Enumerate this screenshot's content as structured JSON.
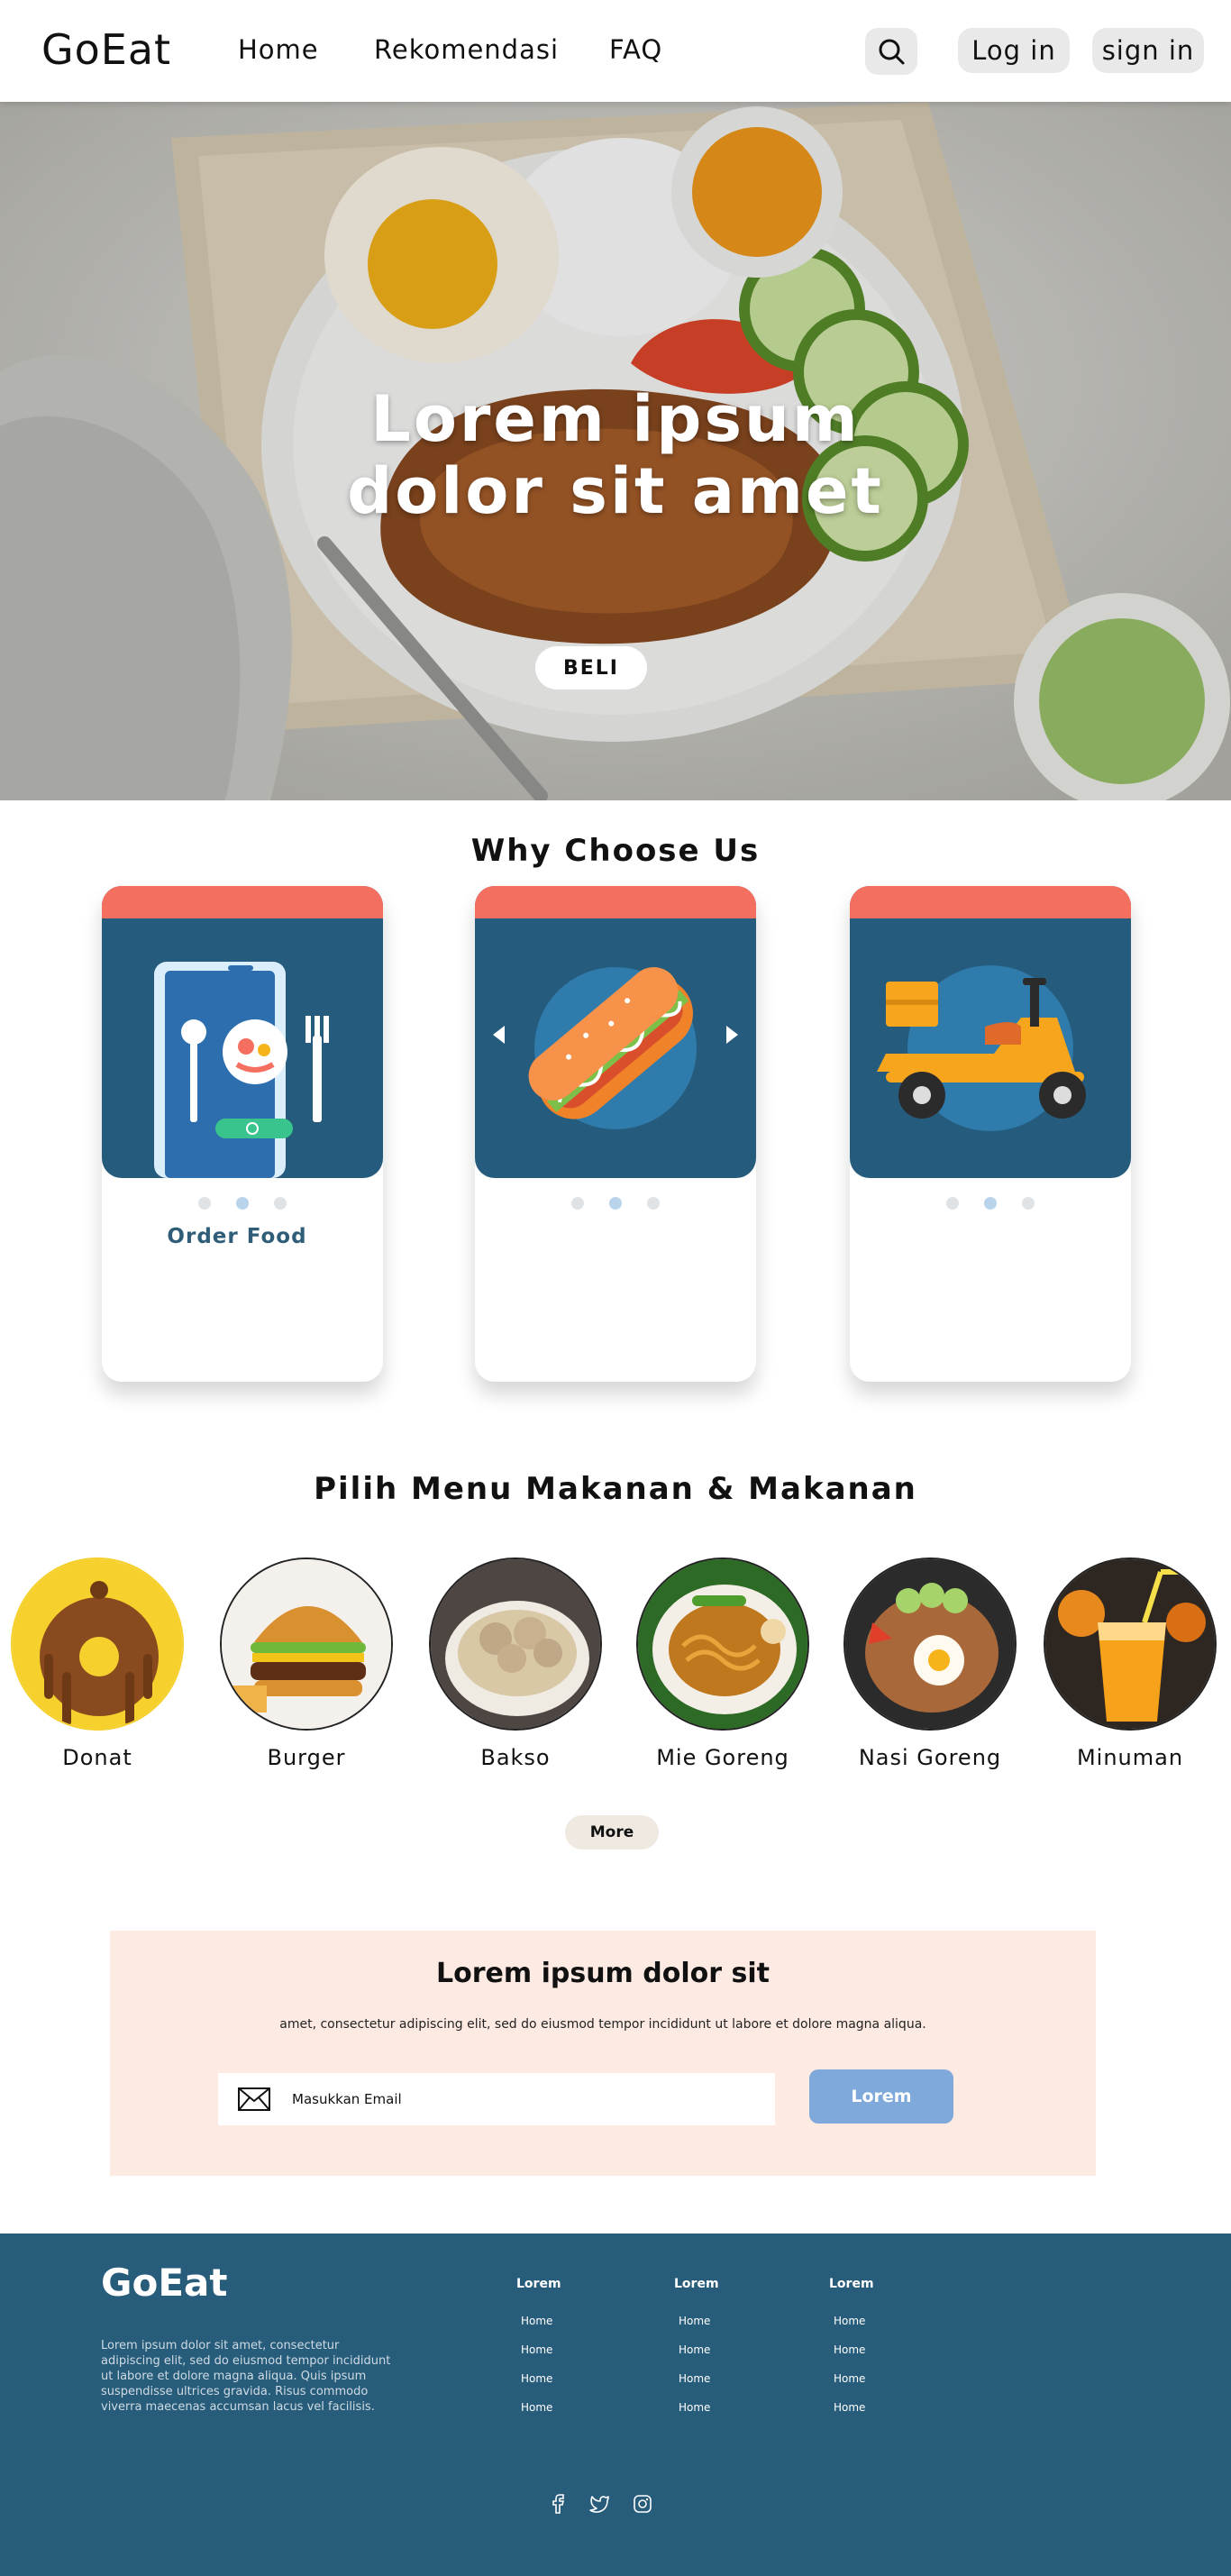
{
  "nav": {
    "logo": "GoEat",
    "links": [
      "Home",
      "Rekomendasi",
      "FAQ"
    ],
    "search_icon": "search-icon",
    "login_label": "Log in",
    "signin_label": "sign in"
  },
  "hero": {
    "title_line1": "Lorem ipsum",
    "title_line2": "dolor sit amet",
    "button_label": "BELI"
  },
  "why": {
    "title": "Why Choose Us",
    "cards": [
      {
        "icon": "phone-order-icon",
        "label": "Order Food"
      },
      {
        "icon": "hotdog-icon",
        "label": ""
      },
      {
        "icon": "scooter-delivery-icon",
        "label": ""
      }
    ]
  },
  "menu": {
    "title": "Pilih Menu Makanan & Makanan",
    "items": [
      {
        "name": "Donat",
        "icon": "donut-icon"
      },
      {
        "name": "Burger",
        "icon": "burger-icon"
      },
      {
        "name": "Bakso",
        "icon": "bakso-icon"
      },
      {
        "name": "Mie Goreng",
        "icon": "noodle-icon"
      },
      {
        "name": "Nasi Goreng",
        "icon": "fried-rice-icon"
      },
      {
        "name": "Minuman",
        "icon": "drink-icon"
      }
    ],
    "more_label": "More"
  },
  "newsletter": {
    "title": "Lorem ipsum dolor sit",
    "subtitle": "amet, consectetur adipiscing elit, sed do eiusmod tempor incididunt ut labore et dolore magna aliqua.",
    "email_placeholder": "Masukkan Email",
    "button_label": "Lorem"
  },
  "footer": {
    "logo": "GoEat",
    "description": "Lorem ipsum dolor sit amet, consectetur adipiscing elit, sed do eiusmod tempor incididunt ut labore et dolore magna aliqua. Quis ipsum suspendisse ultrices gravida. Risus commodo viverra maecenas accumsan lacus vel facilisis.",
    "columns": [
      {
        "heading": "Lorem",
        "links": [
          "Home",
          "Home",
          "Home",
          "Home"
        ]
      },
      {
        "heading": "Lorem",
        "links": [
          "Home",
          "Home",
          "Home",
          "Home"
        ]
      },
      {
        "heading": "Lorem",
        "links": [
          "Home",
          "Home",
          "Home",
          "Home"
        ]
      }
    ],
    "social": [
      "facebook-icon",
      "twitter-icon",
      "instagram-icon"
    ]
  },
  "colors": {
    "card_bg": "#255c7d",
    "card_top": "#f56f61",
    "footer_bg": "#275c7a",
    "newsletter_bg": "#fdeae3",
    "submit_btn": "#7fa9da"
  }
}
